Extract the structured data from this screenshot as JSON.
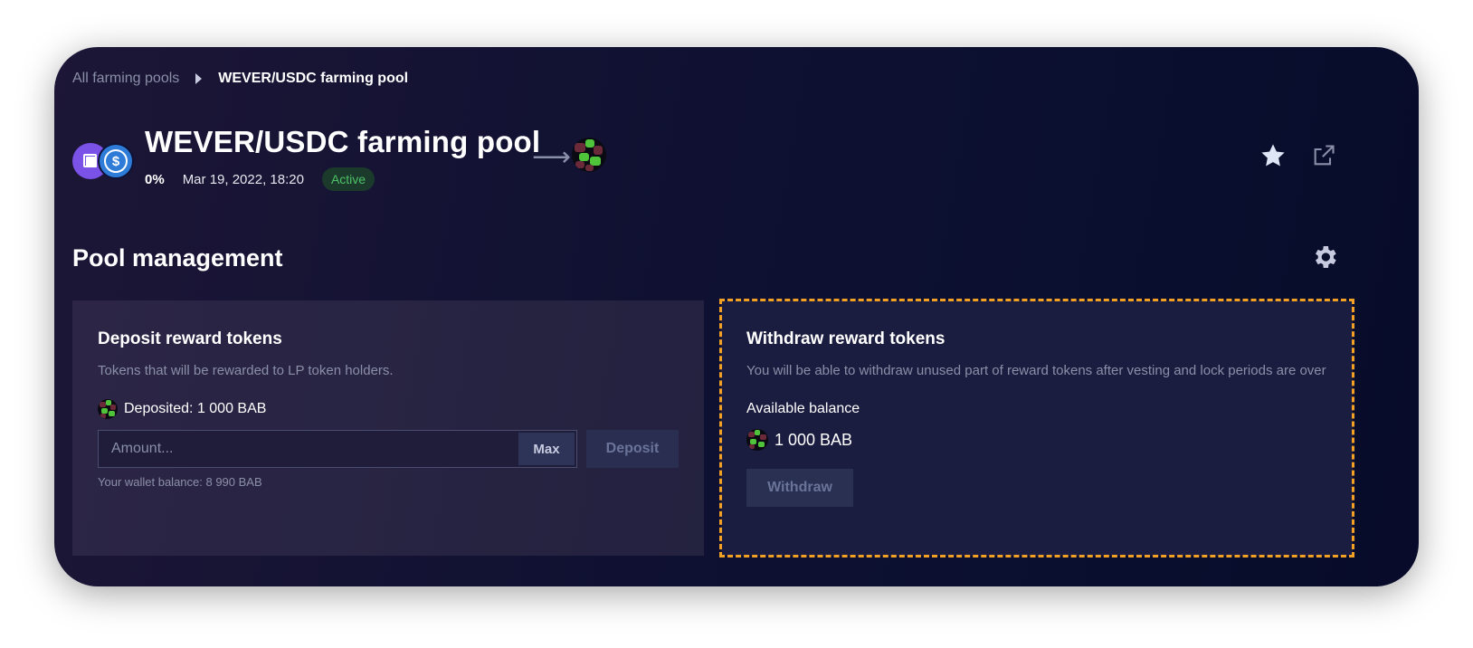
{
  "breadcrumb": {
    "parent": "All farming pools",
    "current": "WEVER/USDC farming pool"
  },
  "header": {
    "title": "WEVER/USDC farming pool",
    "share": "0%",
    "date": "Mar 19, 2022, 18:20",
    "status": "Active",
    "token_icons": [
      "wever-token-icon",
      "usdc-token-icon"
    ],
    "reward_icon": "bab-token-icon",
    "actions": [
      "star-icon",
      "external-link-icon"
    ]
  },
  "section": {
    "title": "Pool management",
    "settings_icon": "gear-icon"
  },
  "deposit": {
    "title": "Deposit reward tokens",
    "description": "Tokens that will be rewarded to LP token holders.",
    "deposited": "Deposited: 1 000 BAB",
    "amount_placeholder": "Amount...",
    "max_label": "Max",
    "button_label": "Deposit",
    "wallet_balance": "Your wallet balance: 8 990 BAB"
  },
  "withdraw": {
    "title": "Withdraw reward tokens",
    "description": "You will be able to withdraw unused part of reward tokens after vesting and lock periods are over",
    "available_label": "Available balance",
    "available_value": "1 000 BAB",
    "button_label": "Withdraw"
  },
  "colors": {
    "accent_dashed": "#f2a125",
    "status_green": "#4cc266",
    "background": "#0b0f30"
  }
}
